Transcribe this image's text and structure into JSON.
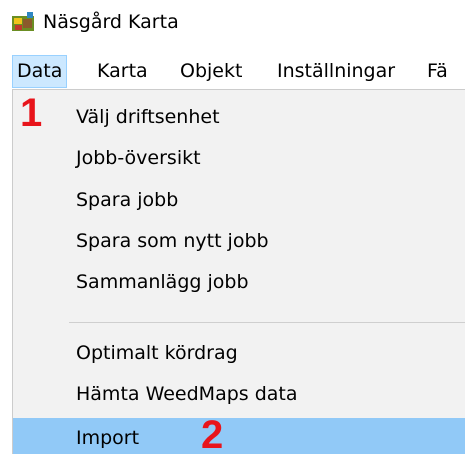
{
  "window": {
    "title": "Näsgård Karta",
    "icon": "map-app-icon"
  },
  "menubar": {
    "items": [
      {
        "label": "Data",
        "active": true
      },
      {
        "label": "Karta"
      },
      {
        "label": "Objekt"
      },
      {
        "label": "Inställningar"
      },
      {
        "label": "Fä"
      }
    ]
  },
  "dropdown": {
    "items": [
      {
        "label": "Välj driftsenhet"
      },
      {
        "label": "Jobb-översikt"
      },
      {
        "label": "Spara jobb"
      },
      {
        "label": "Spara som nytt jobb"
      },
      {
        "label": "Sammanlägg jobb"
      },
      {
        "label": "Optimalt kördrag"
      },
      {
        "label": "Hämta WeedMaps data"
      },
      {
        "label": "Import",
        "highlighted": true
      }
    ]
  },
  "annotations": {
    "step1": "1",
    "step2": "2",
    "color": "#e8141b"
  },
  "colors": {
    "menu_active_bg": "#cce8ff",
    "menu_active_border": "#99d1ff",
    "dropdown_bg": "#f2f2f2",
    "item_highlight": "#91c9f7"
  }
}
